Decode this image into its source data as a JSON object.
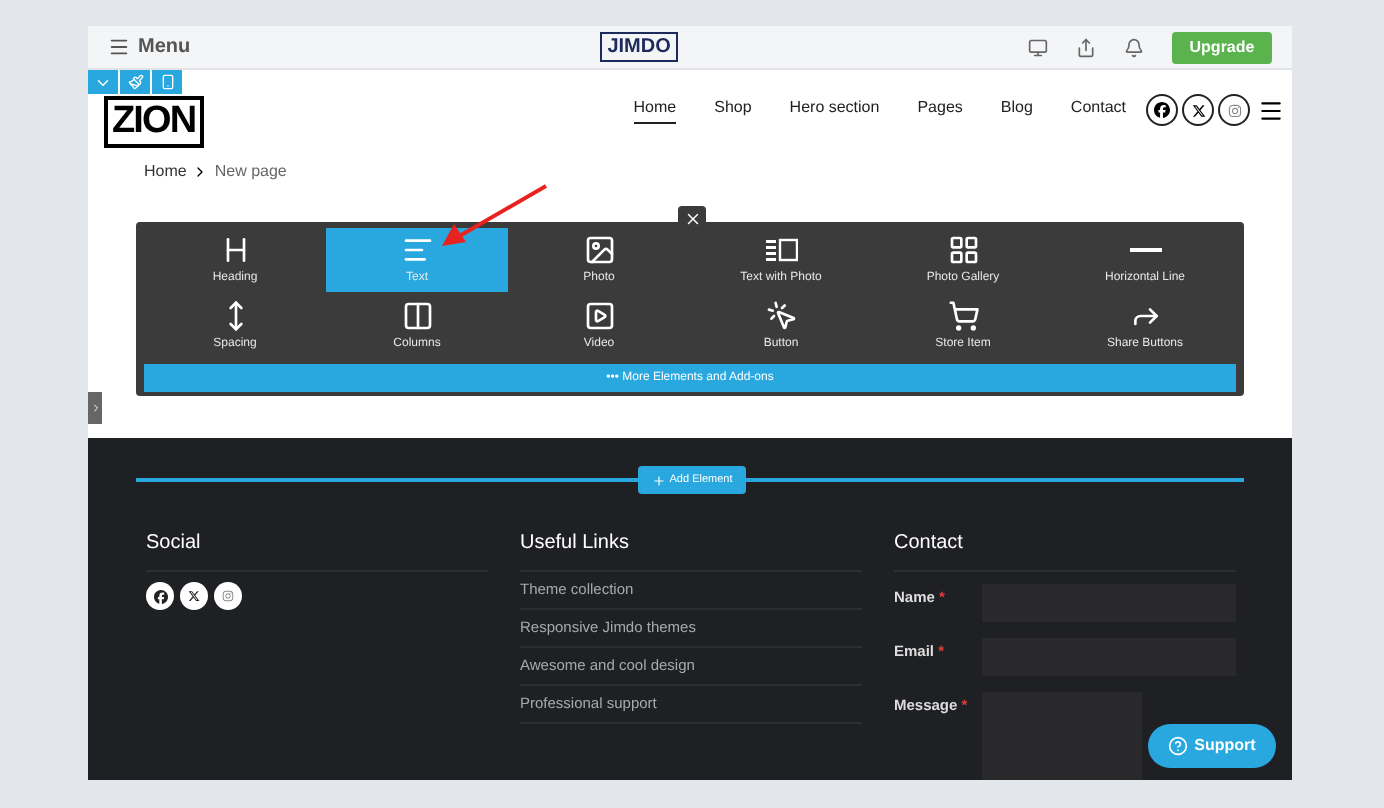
{
  "top_bar": {
    "menu_label": "Menu",
    "logo": "JIMDO",
    "upgrade_button": "Upgrade"
  },
  "site_header": {
    "logo": "ZION",
    "nav": [
      {
        "label": "Home",
        "selected": true
      },
      {
        "label": "Shop",
        "selected": false
      },
      {
        "label": "Hero section",
        "selected": false
      },
      {
        "label": "Pages",
        "selected": false
      },
      {
        "label": "Blog",
        "selected": false
      },
      {
        "label": "Contact",
        "selected": false
      }
    ]
  },
  "breadcrumb": [
    "Home",
    "New page"
  ],
  "element_palette": {
    "items": [
      {
        "label": "Heading",
        "kind": "heading",
        "selected": false
      },
      {
        "label": "Text",
        "kind": "text",
        "selected": true
      },
      {
        "label": "Photo",
        "kind": "photo",
        "selected": false
      },
      {
        "label": "Text with Photo",
        "kind": "textphoto",
        "selected": false
      },
      {
        "label": "Photo Gallery",
        "kind": "gallery",
        "selected": false
      },
      {
        "label": "Horizontal Line",
        "kind": "line",
        "selected": false
      },
      {
        "label": "Spacing",
        "kind": "spacing",
        "selected": false
      },
      {
        "label": "Columns",
        "kind": "columns",
        "selected": false
      },
      {
        "label": "Video",
        "kind": "video",
        "selected": false
      },
      {
        "label": "Button",
        "kind": "button",
        "selected": false
      },
      {
        "label": "Store Item",
        "kind": "store",
        "selected": false
      },
      {
        "label": "Share Buttons",
        "kind": "share",
        "selected": false
      }
    ],
    "more_button": "••• More Elements and Add-ons"
  },
  "footer": {
    "add_element_button": "Add Element",
    "social": {
      "title": "Social"
    },
    "useful_links": {
      "title": "Useful Links",
      "links": [
        "Theme collection",
        "Responsive Jimdo themes",
        "Awesome and cool design",
        "Professional support"
      ]
    },
    "contact": {
      "title": "Contact",
      "fields": [
        {
          "label": "Name",
          "required_mark": "*",
          "kind": "input"
        },
        {
          "label": "Email",
          "required_mark": "*",
          "kind": "input"
        },
        {
          "label": "Message",
          "required_mark": "*",
          "kind": "textarea"
        }
      ]
    }
  },
  "support_button": "Support"
}
